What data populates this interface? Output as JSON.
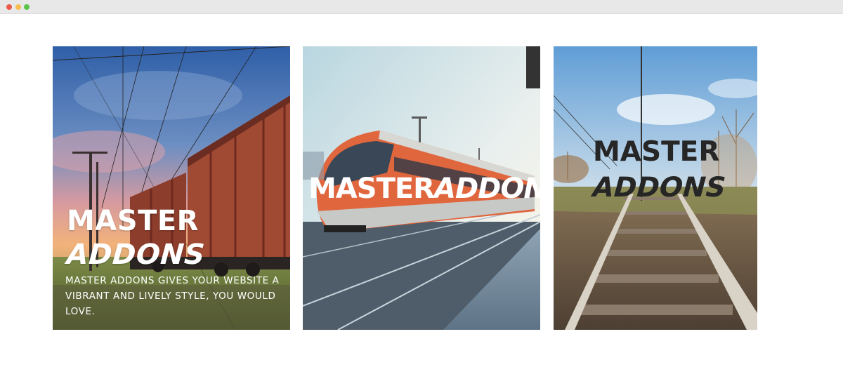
{
  "window": {
    "controls": [
      "close",
      "minimize",
      "maximize"
    ]
  },
  "cards": [
    {
      "title_line1": "MASTER",
      "title_line2": "ADDONS",
      "description": "MASTER ADDONS GIVES YOUR WEBSITE A VIBRANT AND LIVELY STYLE, YOU WOULD LOVE.",
      "text_color": "#ffffff",
      "image": "freight-train-at-sunset"
    },
    {
      "title_part1": "MASTER",
      "title_part2": "ADDONS",
      "text_color": "#ffffff",
      "image": "red-passenger-train-at-platform"
    },
    {
      "title_line1": "MASTER",
      "title_line2": "ADDONS",
      "text_color": "#262626",
      "image": "railroad-tracks-countryside"
    }
  ],
  "colors": {
    "titlebar": "#e8e8e8",
    "close_dot": "#ed594a",
    "minimize_dot": "#f5be4f",
    "maximize_dot": "#5bc449"
  }
}
